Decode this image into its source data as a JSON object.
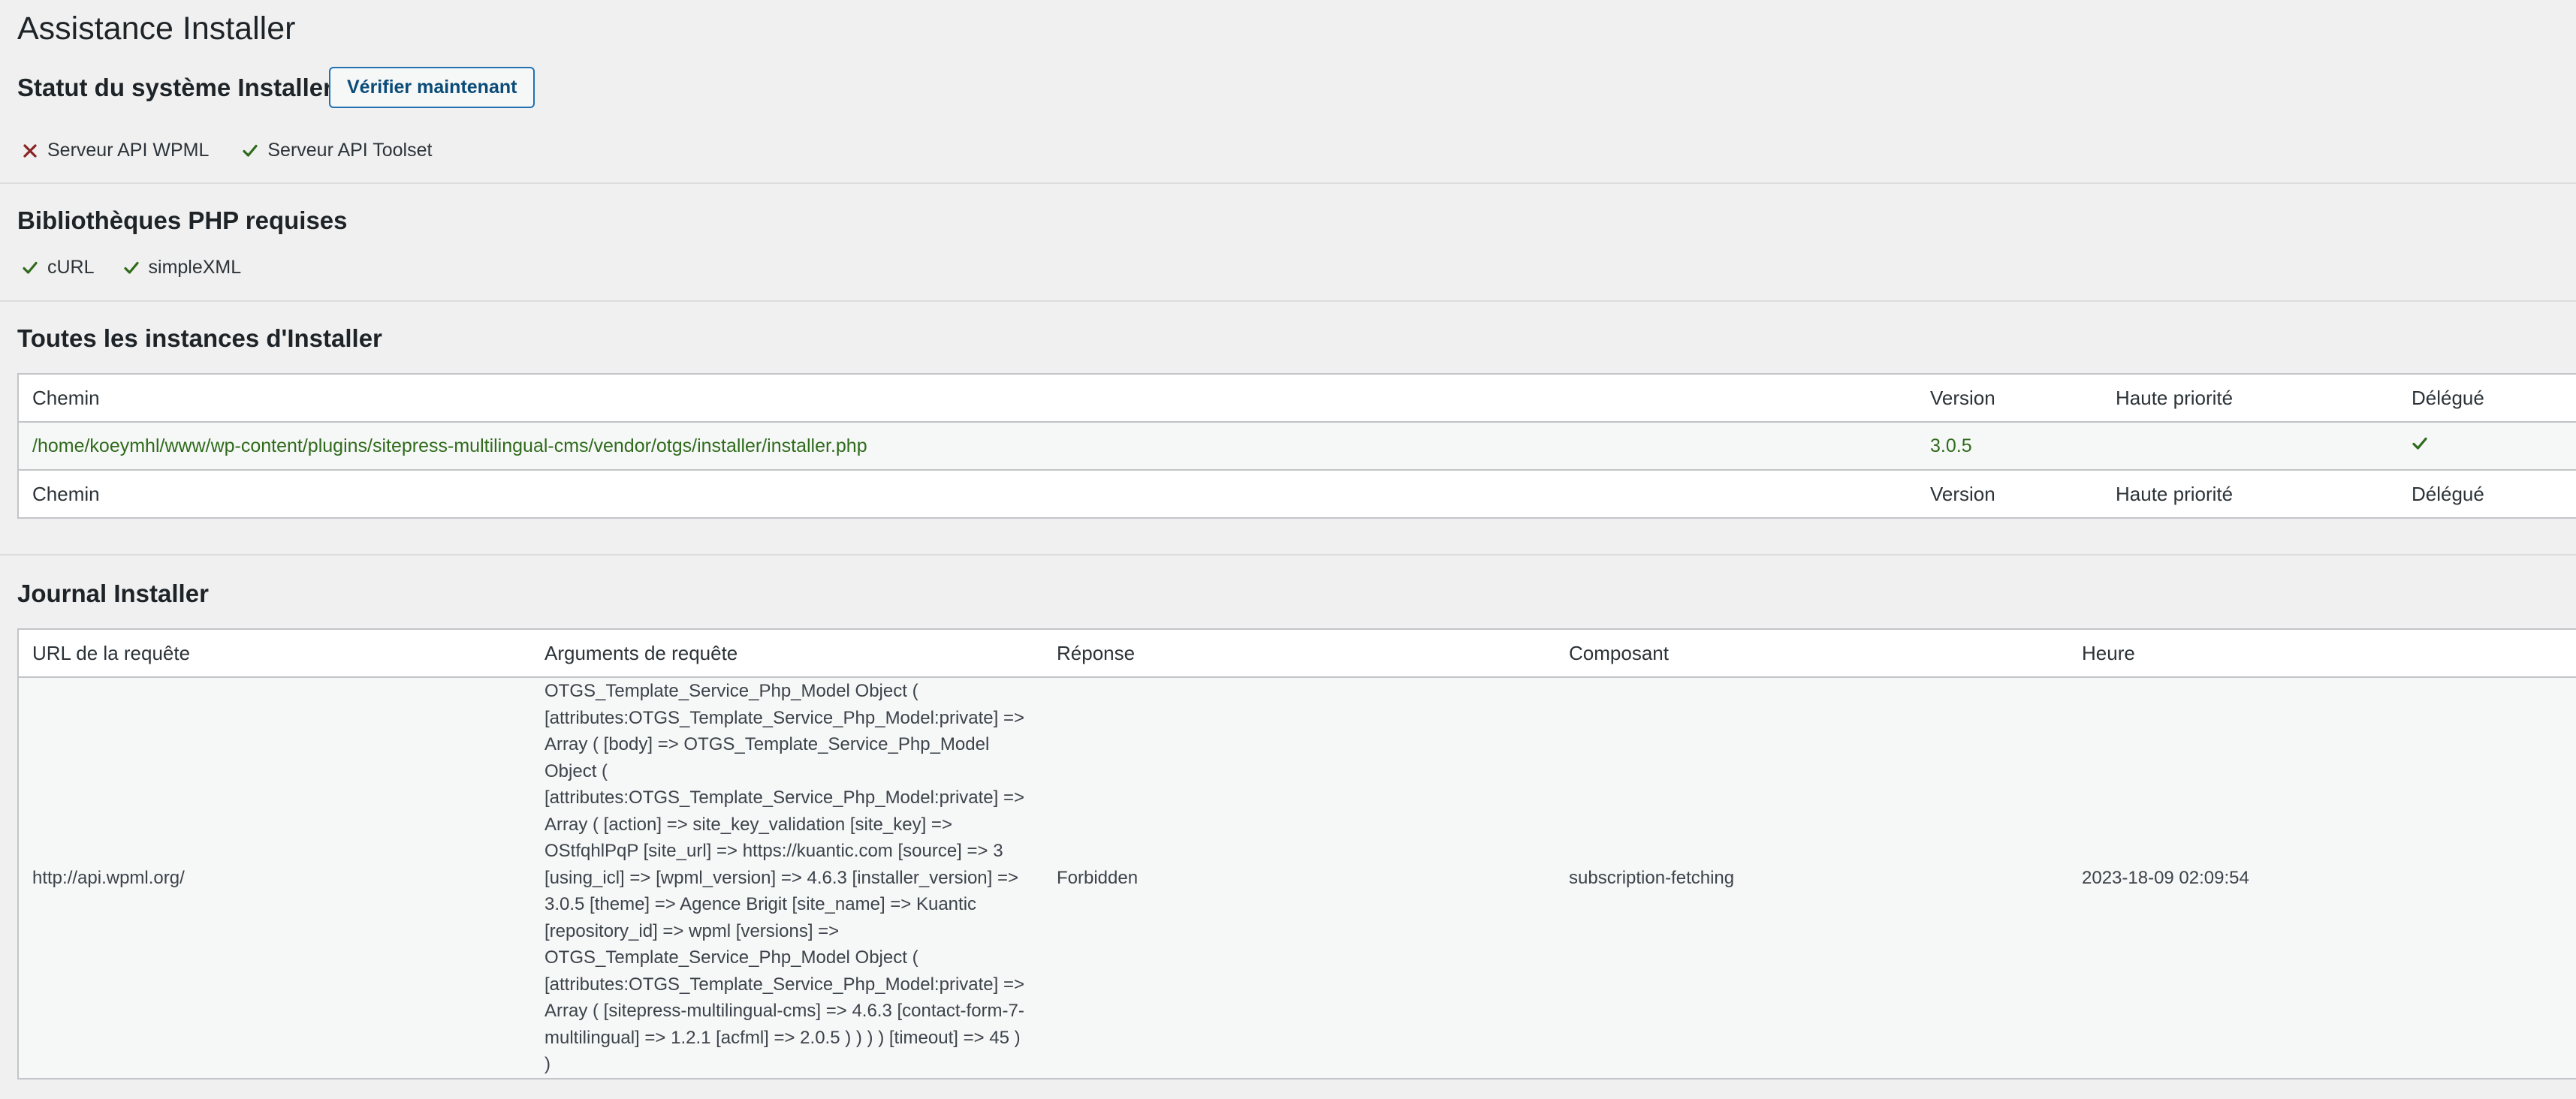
{
  "page": {
    "title": "Assistance Installer"
  },
  "system_status": {
    "heading": "Statut du système Installer",
    "check_button": "Vérifier maintenant",
    "items": [
      {
        "label": "Serveur API WPML",
        "status": "error",
        "icon": "cross-icon"
      },
      {
        "label": "Serveur API Toolset",
        "status": "ok",
        "icon": "checkmark-icon"
      }
    ]
  },
  "php_libraries": {
    "heading": "Bibliothèques PHP requises",
    "items": [
      {
        "label": "cURL",
        "status": "ok",
        "icon": "checkmark-icon"
      },
      {
        "label": "simpleXML",
        "status": "ok",
        "icon": "checkmark-icon"
      }
    ]
  },
  "instances": {
    "heading": "Toutes les instances d'Installer",
    "columns": [
      "Chemin",
      "Version",
      "Haute priorité",
      "Délégué"
    ],
    "rows": [
      {
        "path": "/home/koeymhl/www/wp-content/plugins/sitepress-multilingual-cms/vendor/otgs/installer/installer.php",
        "version": "3.0.5",
        "high_priority": "",
        "delegated_icon": "checkmark-icon"
      }
    ]
  },
  "log": {
    "heading": "Journal Installer",
    "columns": [
      "URL de la requête",
      "Arguments de requête",
      "Réponse",
      "Composant",
      "Heure"
    ],
    "rows": [
      {
        "url": "http://api.wpml.org/",
        "args": "OTGS_Template_Service_Php_Model Object ( [attributes:OTGS_Template_Service_Php_Model:private] => Array ( [body] => OTGS_Template_Service_Php_Model Object ( [attributes:OTGS_Template_Service_Php_Model:private] => Array ( [action] => site_key_validation [site_key] => OStfqhlPqP [site_url] => https://kuantic.com [source] => 3 [using_icl] => [wpml_version] => 4.6.3 [installer_version] => 3.0.5 [theme] => Agence Brigit [site_name] => Kuantic [repository_id] => wpml [versions] => OTGS_Template_Service_Php_Model Object ( [attributes:OTGS_Template_Service_Php_Model:private] => Array ( [sitepress-multilingual-cms] => 4.6.3 [contact-form-7-multilingual] => 1.2.1 [acfml] => 2.0.5 ) ) ) ) [timeout] => 45 ) )",
        "response": "Forbidden",
        "component": "subscription-fetching",
        "time": "2023-18-09 02:09:54"
      }
    ]
  },
  "colors": {
    "ok": "#2f6b1b",
    "error": "#8a2424",
    "accent": "#2271b1"
  }
}
